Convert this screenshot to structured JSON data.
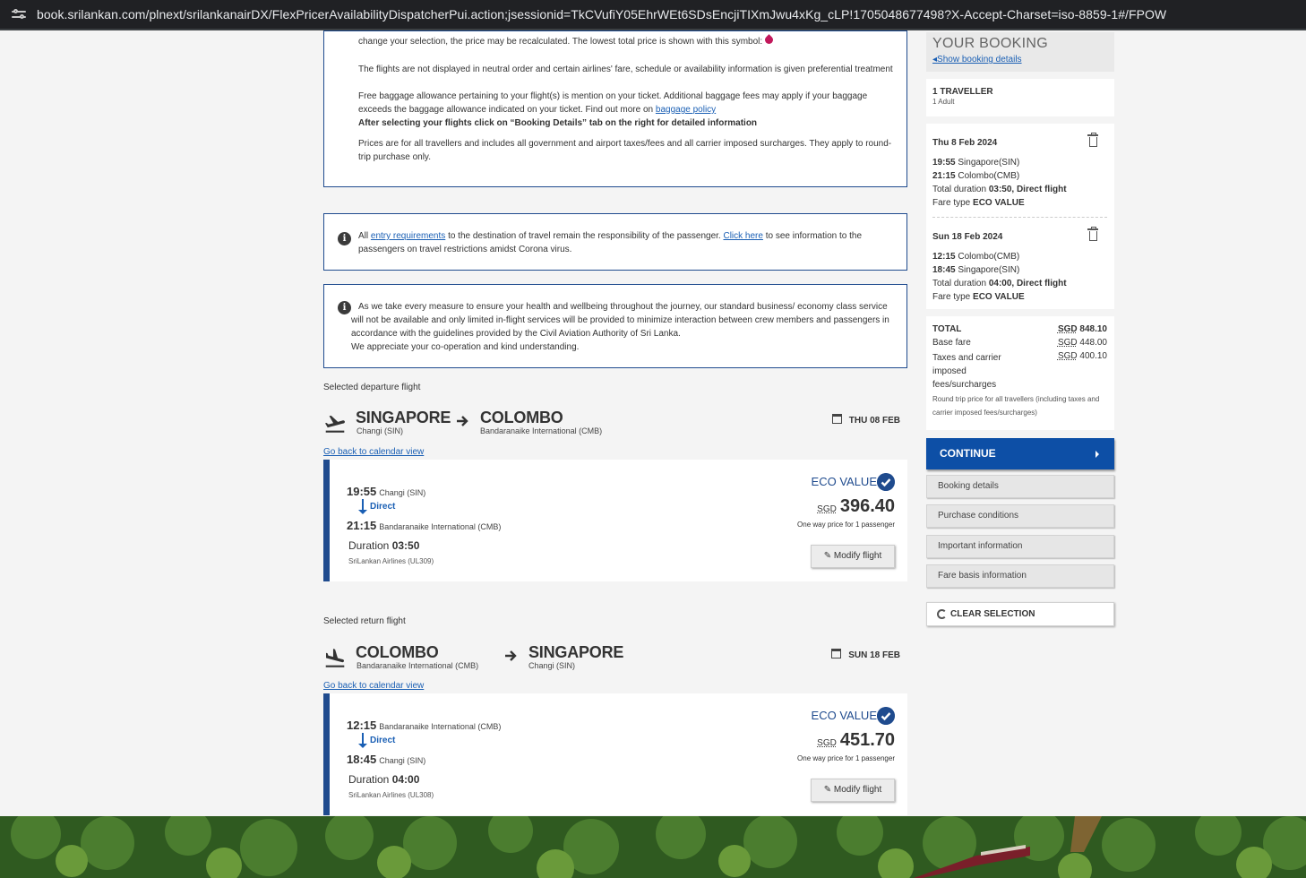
{
  "browser": {
    "url": "book.srilankan.com/plnext/srilankanairDX/FlexPricerAvailabilityDispatcherPui.action;jsessionid=TkCVufiY05EhrWEt6SDsEncjiTIXmJwu4xKg_cLP!1705048677498?X-Accept-Charset=iso-8859-1#/FPOW"
  },
  "notice": {
    "line_top": "change your selection, the price may be recalculated. The lowest total price is shown with this symbol:",
    "neutral_order": "The flights are not displayed in neutral order and certain airlines' fare, schedule or availability information is given preferential treatment",
    "baggage_text": "Free baggage allowance pertaining to your flight(s) is mention on your ticket. Additional baggage fees may apply if your baggage exceeds the baggage allowance indicated on your ticket. Find out more on",
    "baggage_link": "baggage policy",
    "booking_details_note": "After selecting your flights click on “Booking Details” tab on the right for detailed information",
    "prices_note": "Prices are for all travellers and includes all government and airport taxes/fees and all carrier imposed surcharges. They apply to round-trip purchase only."
  },
  "entry_info": {
    "pre": "All",
    "link1": "entry requirements",
    "mid": "to the destination of travel remain the responsibility of the passenger.",
    "link2": "Click here",
    "post": "to see information to the passengers on travel restrictions amidst Corona virus."
  },
  "health_info": {
    "text": "As we take every measure to ensure your health and wellbeing throughout the journey, our standard business/ economy class service will not be available and only limited in-flight services will be provided to minimize interaction between crew members and passengers in accordance with the guidelines provided by the Civil Aviation Authority of Sri Lanka.",
    "thanks": "We appreciate your co-operation and kind understanding."
  },
  "departure": {
    "section_label": "Selected departure flight",
    "from_city": "SINGAPORE",
    "from_airport": "Changi (SIN)",
    "to_city": "COLOMBO",
    "to_airport": "Bandaranaike International (CMB)",
    "date": "THU 08 FEB",
    "back_link": "Go back to calendar view",
    "dep_time": "19:55",
    "dep_airport": "Changi (SIN)",
    "direct": "Direct",
    "arr_time": "21:15",
    "arr_airport": "Bandaranaike International (CMB)",
    "duration_label": "Duration",
    "duration": "03:50",
    "airline": "SriLankan Airlines (UL309)",
    "fare_type": "ECO VALUE",
    "currency": "SGD",
    "price": "396.40",
    "price_note": "One way price for 1 passenger",
    "modify": "Modify flight"
  },
  "return": {
    "section_label": "Selected return flight",
    "from_city": "COLOMBO",
    "from_airport": "Bandaranaike International (CMB)",
    "to_city": "SINGAPORE",
    "to_airport": "Changi (SIN)",
    "date": "SUN 18 FEB",
    "back_link": "Go back to calendar view",
    "dep_time": "12:15",
    "dep_airport": "Bandaranaike International (CMB)",
    "direct": "Direct",
    "arr_time": "18:45",
    "arr_airport": "Changi (SIN)",
    "duration_label": "Duration",
    "duration": "04:00",
    "airline": "SriLankan Airlines (UL308)",
    "fare_type": "ECO VALUE",
    "currency": "SGD",
    "price": "451.70",
    "price_note": "One way price for 1 passenger",
    "modify": "Modify flight"
  },
  "booking": {
    "title": "YOUR BOOKING",
    "show_details": "Show booking details",
    "travellers": "1 TRAVELLER",
    "travellers_sub": "1 Adult",
    "outbound": {
      "date": "Thu 8 Feb 2024",
      "dep_time": "19:55",
      "dep_place": "Singapore(SIN)",
      "arr_time": "21:15",
      "arr_place": "Colombo(CMB)",
      "duration_label": "Total duration",
      "duration": "03:50, Direct flight",
      "fare_label": "Fare type",
      "fare": "ECO VALUE"
    },
    "inbound": {
      "date": "Sun 18 Feb 2024",
      "dep_time": "12:15",
      "dep_place": "Colombo(CMB)",
      "arr_time": "18:45",
      "arr_place": "Singapore(SIN)",
      "duration_label": "Total duration",
      "duration": "04:00, Direct flight",
      "fare_label": "Fare type",
      "fare": "ECO VALUE"
    },
    "total_label": "TOTAL",
    "total_currency": "SGD",
    "total": "848.10",
    "base_label": "Base fare",
    "base_currency": "SGD",
    "base": "448.00",
    "taxes_label": "Taxes and carrier imposed fees/surcharges",
    "taxes_currency": "SGD",
    "taxes": "400.10",
    "round_trip_note": "Round trip price for all travellers (including taxes and carrier imposed fees/surcharges)",
    "continue": "CONTINUE",
    "menu": [
      "Booking details",
      "Purchase conditions",
      "Important information",
      "Fare basis information"
    ],
    "clear": "CLEAR SELECTION"
  },
  "colors": {
    "brand_blue": "#0d4fa6",
    "border_blue": "#1f4b8e",
    "link_blue": "#1a5fb4",
    "pink_symbol": "#c2185b"
  }
}
